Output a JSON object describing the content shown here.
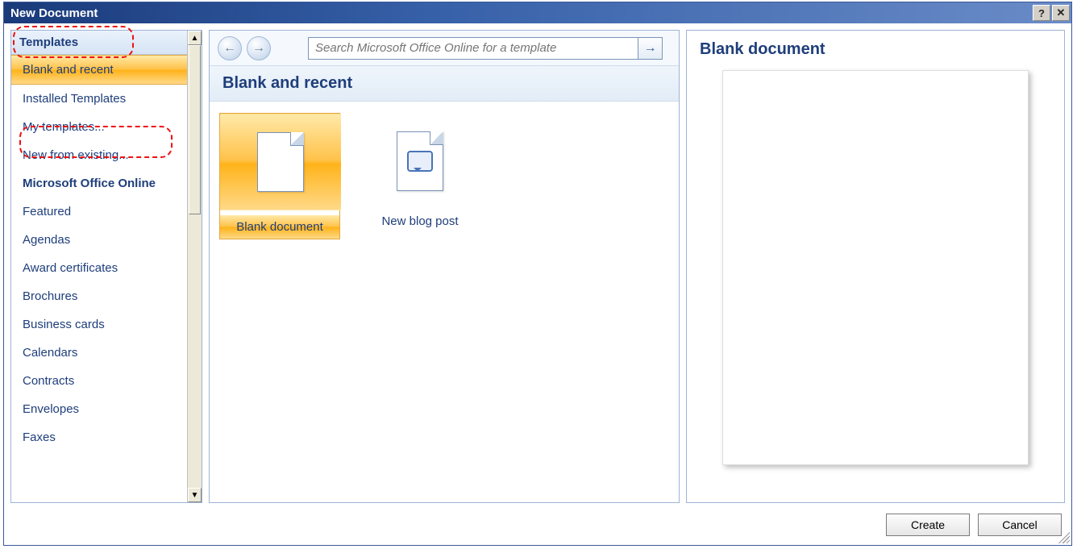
{
  "window": {
    "title": "New Document"
  },
  "sidebar": {
    "header": "Templates",
    "items": [
      {
        "label": "Blank and recent",
        "selected": true
      },
      {
        "label": "Installed Templates"
      },
      {
        "label": "My templates..."
      },
      {
        "label": "New from existing..."
      },
      {
        "label": "Microsoft Office Online",
        "section": true
      },
      {
        "label": "Featured"
      },
      {
        "label": "Agendas"
      },
      {
        "label": "Award certificates"
      },
      {
        "label": "Brochures"
      },
      {
        "label": "Business cards"
      },
      {
        "label": "Calendars"
      },
      {
        "label": "Contracts"
      },
      {
        "label": "Envelopes"
      },
      {
        "label": "Faxes"
      }
    ]
  },
  "center": {
    "search_placeholder": "Search Microsoft Office Online for a template",
    "section_title": "Blank and recent",
    "thumbs": [
      {
        "label": "Blank document",
        "selected": true,
        "kind": "doc"
      },
      {
        "label": "New blog post",
        "kind": "blog"
      }
    ]
  },
  "preview": {
    "title": "Blank document"
  },
  "footer": {
    "create": "Create",
    "cancel": "Cancel"
  }
}
